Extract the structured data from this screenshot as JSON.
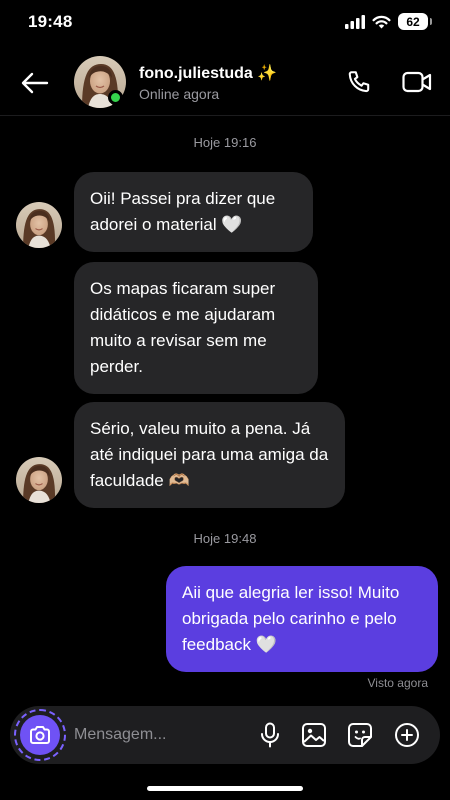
{
  "status_bar": {
    "time": "19:48",
    "battery": "62"
  },
  "header": {
    "contact_name": "fono.juliestuda ✨",
    "contact_status": "Online agora"
  },
  "conversation": {
    "timestamp_1": "Hoje 19:16",
    "timestamp_2": "Hoje 19:48",
    "messages": [
      {
        "direction": "in",
        "text": "Oii! Passei pra dizer que adorei o material 🤍"
      },
      {
        "direction": "in",
        "text": "Os mapas ficaram super didáticos e me ajudaram muito a revisar sem me perder."
      },
      {
        "direction": "in",
        "text": "Sério, valeu muito a pena. Já até indiquei para uma amiga da faculdade 🫶🏼"
      },
      {
        "direction": "out",
        "text": "Aii que alegria ler isso! Muito obrigada pelo carinho e pelo feedback 🤍"
      }
    ],
    "seen_label": "Visto agora"
  },
  "composer": {
    "placeholder": "Mensagem..."
  },
  "colors": {
    "outgoing_bubble": "#5b3ee0",
    "incoming_bubble": "#262628",
    "online": "#35d44d",
    "camera_button": "#6f52f5"
  },
  "icons": [
    "back-arrow-icon",
    "phone-icon",
    "video-camera-icon",
    "camera-icon",
    "microphone-icon",
    "image-icon",
    "sticker-icon",
    "plus-icon",
    "signal-icon",
    "wifi-icon",
    "battery-icon"
  ]
}
